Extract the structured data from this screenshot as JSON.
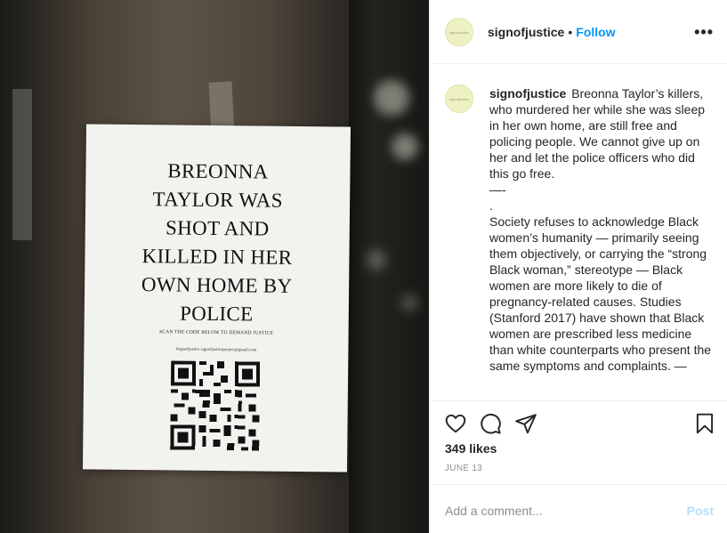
{
  "photo": {
    "poster_headline": "BREONNA\nTAYLOR WAS\nSHOT AND\nKILLED IN HER\nOWN HOME BY\nPOLICE",
    "poster_scan_text": "SCAN THE CODE BELOW TO DEMAND JUSTICE",
    "poster_email": "#signofjustice signofjusticeproject@gmail.com"
  },
  "header": {
    "avatar_text": "signofjustice",
    "username": "signofjustice",
    "separator": "•",
    "follow_label": "Follow",
    "more_icon": "more-horizontal-icon",
    "more_glyph": "•••"
  },
  "caption": {
    "avatar_text": "signofjustice",
    "username": "signofjustice",
    "text": "Breonna Taylor’s killers, who murdered her while she was sleep in her own home, are still free and policing people. We cannot give up on her and let the police officers who did this go free.\n—-\n.\nSociety refuses to acknowledge Black women’s humanity — primarily seeing them objectively, or carrying the “strong Black woman,” stereotype — Black women are more likely to die of pregnancy-related causes. Studies (Stanford 2017) have shown that Black women are prescribed less medicine than white counterparts who present the same symptoms and complaints. —"
  },
  "actions": {
    "like_icon": "heart-icon",
    "comment_icon": "comment-icon",
    "share_icon": "send-icon",
    "save_icon": "bookmark-icon"
  },
  "likes": "349 likes",
  "date": "JUNE 13",
  "comment": {
    "placeholder": "Add a comment...",
    "post_label": "Post"
  },
  "colors": {
    "link_blue": "#0095f6",
    "post_disabled": "#b2dffc",
    "muted": "#8e8e8e",
    "avatar_bg": "#eef2c2"
  }
}
